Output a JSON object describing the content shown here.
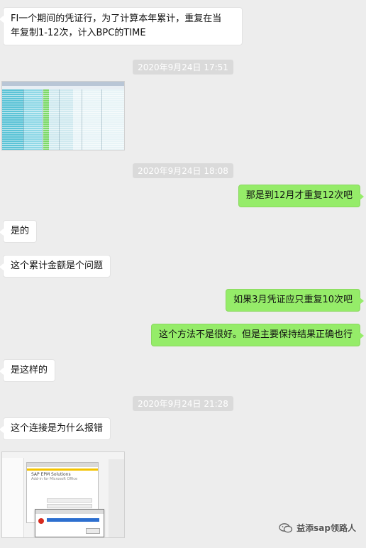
{
  "messages": [
    {
      "side": "left",
      "text": "FI一个期间的凭证行，为了计算本年累计，重复在当"
    },
    {
      "side": "left",
      "text": "年复制1-12次，计入BPC的TIME"
    },
    {
      "timestamp": "2020年9月24日 17:51"
    },
    {
      "timestamp": "2020年9月24日 18:08"
    },
    {
      "side": "right",
      "text": "那是到12月才重复12次吧"
    },
    {
      "side": "left",
      "text": "是的"
    },
    {
      "side": "left",
      "text": "这个累计金额是个问题"
    },
    {
      "side": "right",
      "text": "如果3月凭证应只重复10次吧"
    },
    {
      "side": "right",
      "text": "这个方法不是很好。但是主要保持结果正确也行"
    },
    {
      "side": "left",
      "text": "是这样的"
    },
    {
      "timestamp": "2020年9月24日 21:28"
    },
    {
      "side": "left",
      "text": "这个连接是为什么报错"
    }
  ],
  "sap_thumbnail": {
    "title": "SAP EPM Solutions",
    "subtitle": "Add-in for Microsoft Office"
  },
  "watermark": {
    "text": "益添sap领路人",
    "icon": "wechat-official-account-icon"
  },
  "colors": {
    "background": "#ededed",
    "sent_bubble": "#95ec69",
    "received_bubble": "#ffffff",
    "timestamp_pill": "#dadada"
  }
}
